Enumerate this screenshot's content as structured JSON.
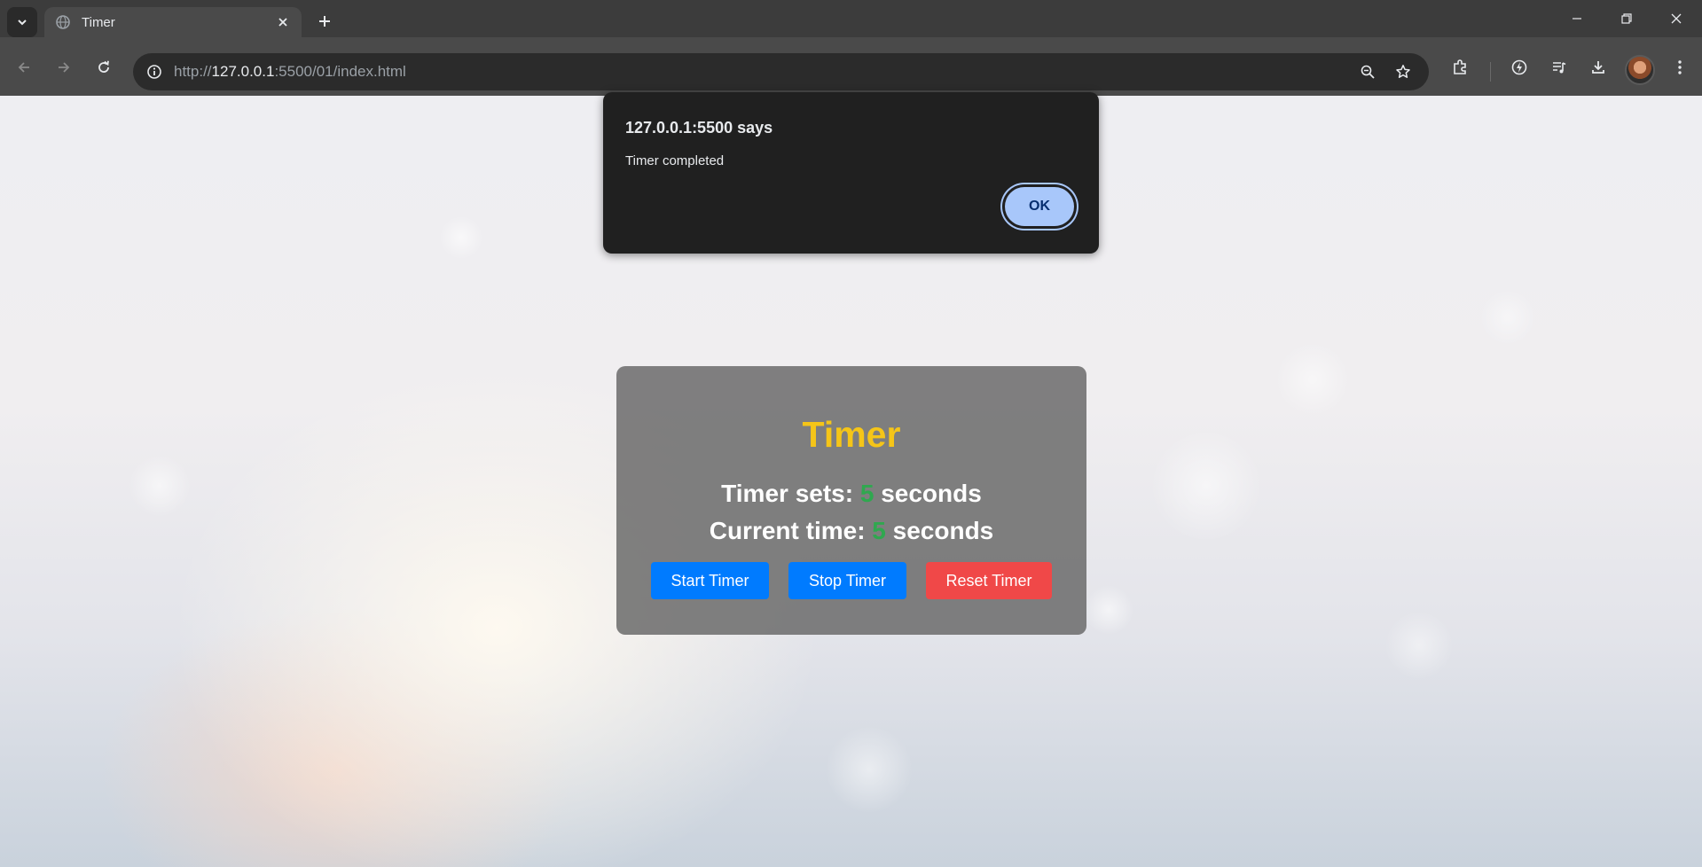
{
  "browser": {
    "tab": {
      "title": "Timer"
    },
    "address_bar": {
      "scheme": "http://",
      "host": "127.0.0.1",
      "rest": ":5500/01/index.html"
    }
  },
  "dialog": {
    "title": "127.0.0.1:5500 says",
    "message": "Timer completed",
    "ok_label": "OK"
  },
  "timer": {
    "heading": "Timer",
    "set_label": "Timer sets:",
    "set_value": "5",
    "set_unit": "seconds",
    "current_label": "Current time:",
    "current_value": "5",
    "current_unit": "seconds",
    "buttons": {
      "start": "Start Timer",
      "stop": "Stop Timer",
      "reset": "Reset Timer"
    }
  },
  "colors": {
    "heading": "#f5c518",
    "number": "#2fa84f",
    "primary_button": "#007bff",
    "danger_button": "#f04848",
    "dialog_ok": "#a8c7fa"
  }
}
